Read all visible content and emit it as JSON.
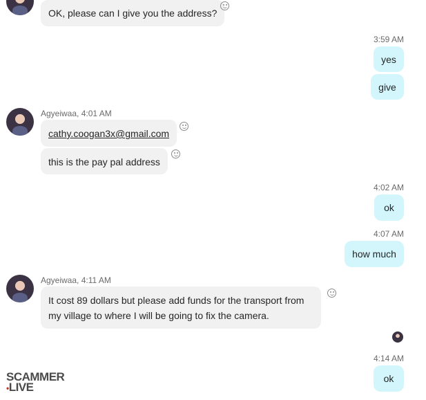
{
  "messages": [
    {
      "id": "m1",
      "from": "them",
      "text": "OK, please can I give you the address?"
    },
    {
      "id": "m2",
      "from": "me",
      "time": "3:59 AM",
      "text": "yes"
    },
    {
      "id": "m3",
      "from": "me",
      "text": "give"
    },
    {
      "id": "m4",
      "from": "them",
      "sender_time": "Agyeiwaa, 4:01 AM",
      "text": "cathy.coogan3x@gmail.com"
    },
    {
      "id": "m5",
      "from": "them",
      "text": "this is the pay pal address"
    },
    {
      "id": "m6",
      "from": "me",
      "time": "4:02 AM",
      "text": "ok"
    },
    {
      "id": "m7",
      "from": "me",
      "time": "4:07 AM",
      "text": "how much"
    },
    {
      "id": "m8",
      "from": "them",
      "sender_time": "Agyeiwaa, 4:11 AM",
      "lines": [
        "It cost 89 dollars but please add funds for the transport from",
        "my village to where I will be going to fix the camera."
      ]
    },
    {
      "id": "m9",
      "from": "me",
      "time": "4:14 AM",
      "text": "ok"
    }
  ],
  "watermark": {
    "line1": "SCAMMER",
    "dot": "•",
    "line2": "LIVE"
  },
  "colors": {
    "incoming_bubble": "#f1f1f1",
    "outgoing_bubble": "#d3f6fd",
    "meta_text": "#6a6a6a"
  },
  "icons": {
    "reaction": "smiley-reaction-icon",
    "avatar": "contact-avatar",
    "read_receipt": "seen-avatar-icon"
  }
}
